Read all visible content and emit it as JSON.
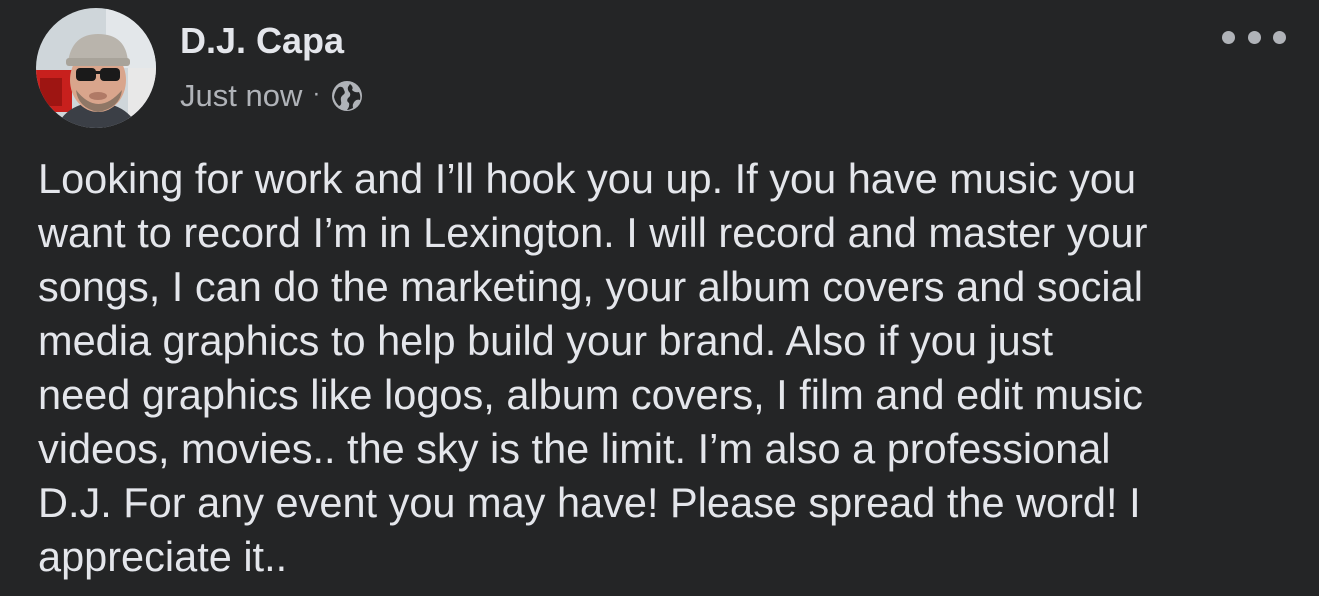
{
  "post": {
    "author_name": "D.J. Capa",
    "timestamp": "Just now",
    "separator": "·",
    "audience_icon": "globe-icon",
    "more_icon": "more-options-icon",
    "lines": [
      "Looking for work and I’ll hook you up. If you have music you",
      "want to record I’m in Lexington. I will record and master your",
      "songs, I can do the marketing, your album covers and social",
      "media graphics to help build your brand. Also if you just",
      "need graphics like logos, album covers, I film and edit music",
      "videos, movies.. the sky is the limit. I’m also a professional",
      "D.J. For any event you may have! Please spread the word! I",
      "appreciate it.."
    ]
  },
  "colors": {
    "background": "#242526",
    "primary_text": "#e4e6eb",
    "secondary_text": "#b0b3b8"
  }
}
